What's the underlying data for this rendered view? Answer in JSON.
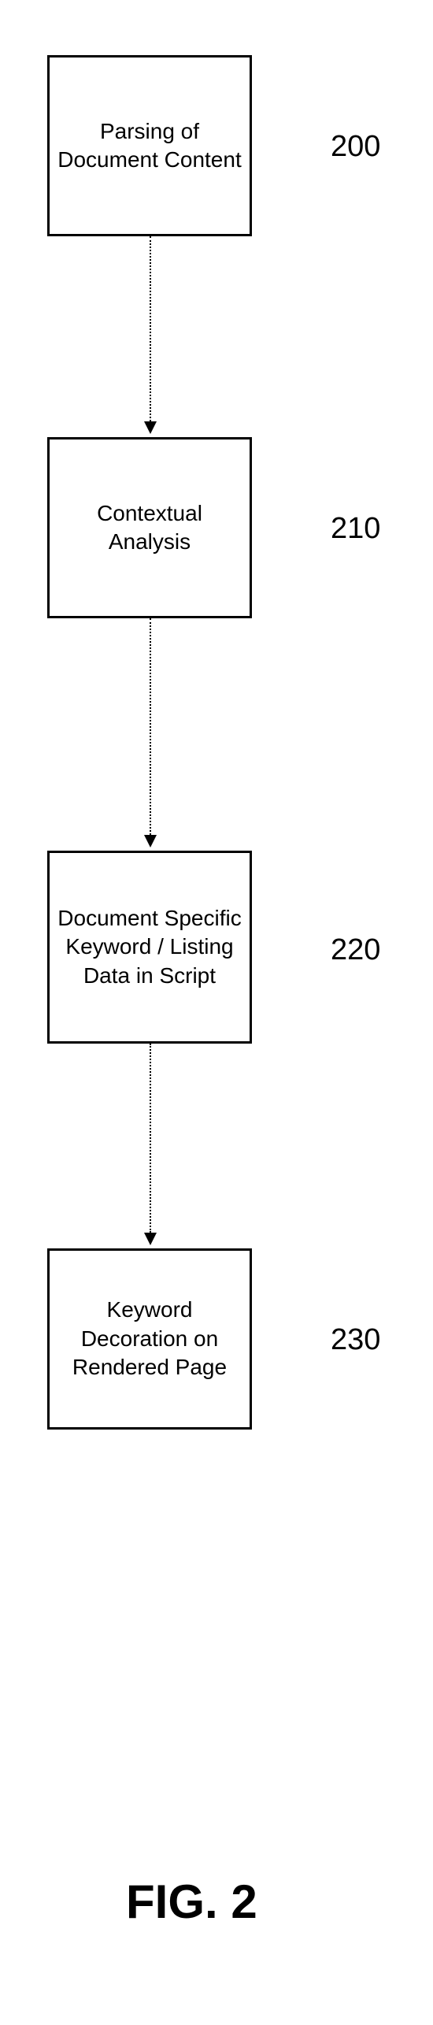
{
  "chart_data": {
    "type": "flowchart",
    "title": "FIG. 2",
    "nodes": [
      {
        "id": "n200",
        "ref": "200",
        "label": "Parsing of Document Content"
      },
      {
        "id": "n210",
        "ref": "210",
        "label": "Contextual Analysis"
      },
      {
        "id": "n220",
        "ref": "220",
        "label": "Document Specific Keyword / Listing Data in Script"
      },
      {
        "id": "n230",
        "ref": "230",
        "label": "Keyword Decoration on Rendered Page"
      }
    ],
    "edges": [
      {
        "from": "n200",
        "to": "n210"
      },
      {
        "from": "n210",
        "to": "n220"
      },
      {
        "from": "n220",
        "to": "n230"
      }
    ]
  },
  "nodes": {
    "n200": {
      "label": "Parsing of Document Content",
      "ref": "200"
    },
    "n210": {
      "label": "Contextual Analysis",
      "ref": "210"
    },
    "n220": {
      "label": "Document Specific Keyword / Listing Data in Script",
      "ref": "220"
    },
    "n230": {
      "label": "Keyword Decoration on Rendered Page",
      "ref": "230"
    }
  },
  "figure": {
    "label": "FIG. 2"
  }
}
